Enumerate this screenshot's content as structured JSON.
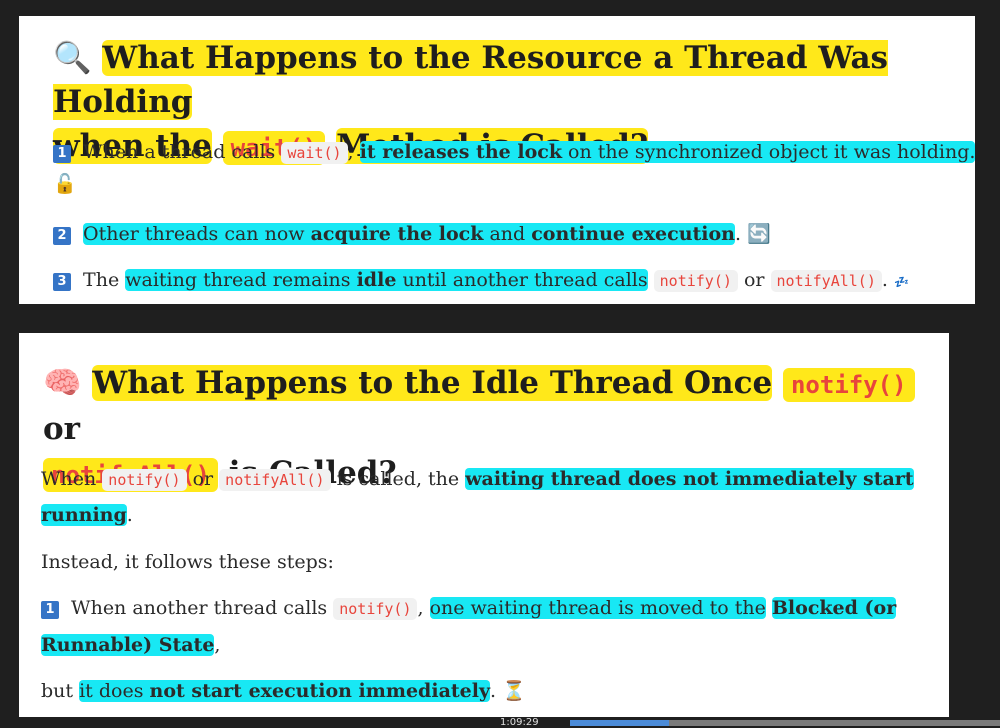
{
  "section1": {
    "emoji": "🔍",
    "title_part1": "What Happens to the Resource a Thread Was Holding",
    "title_part2": "when the",
    "title_code": "wait()",
    "title_part3": "Method is Called?",
    "item1": {
      "num": "1",
      "text1": "When a thread calls",
      "code": "wait()",
      "text2": ",",
      "bold": "it releases the lock",
      "text3": "on the synchronized object it was holding.",
      "emoji": "🔓"
    },
    "item2": {
      "num": "2",
      "text1": "Other threads can now",
      "bold1": "acquire the lock",
      "text2": "and",
      "bold2": "continue execution",
      "text3": ".",
      "emoji": "🔄"
    },
    "item3": {
      "num": "3",
      "text1": "The",
      "text2": "waiting thread remains",
      "bold": "idle",
      "text3": "until another thread calls",
      "code1": "notify()",
      "text4": "or",
      "code2": "notifyAll()",
      "text5": ".",
      "emoji": "💤"
    }
  },
  "section2": {
    "emoji": "🧠",
    "title_part1": "What Happens to the Idle Thread Once",
    "title_code1": "notify()",
    "title_part2": "or",
    "title_code2": "notifyAll()",
    "title_part3": "is Called?",
    "para1": {
      "text1": "When",
      "code1": "notify()",
      "text2": "or",
      "code2": "notifyAll()",
      "text3": "is called, the",
      "bold_a": "waiting thread does not immediately start",
      "bold_b": "running",
      "text4": "."
    },
    "para2": "Instead, it follows these steps:",
    "step1": {
      "num": "1",
      "text1": "When another thread calls",
      "code": "notify()",
      "text2": ",",
      "text3": "one waiting thread is moved to the",
      "bold_a": "Blocked (or",
      "bold_b": "Runnable) State",
      "text4": ","
    },
    "para3": {
      "text1": "but",
      "text2": "it does",
      "bold": "not start execution immediately",
      "text3": ".",
      "emoji": "⏳"
    }
  },
  "player": {
    "time": "1:09:29",
    "progress_fraction": 0.23
  },
  "colors": {
    "yellow_highlight": "#ffe81a",
    "cyan_highlight": "#18e8f4",
    "code_red": "#e8453c",
    "number_badge": "#3574c6"
  }
}
